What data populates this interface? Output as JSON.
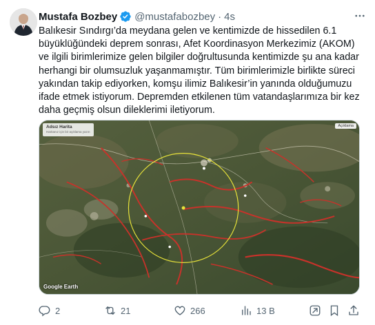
{
  "author": {
    "name": "Mustafa Bozbey",
    "handle": "@mustafabozbey",
    "separator": "·",
    "time": "4s"
  },
  "tweet": {
    "text": "Balıkesir Sındırgı’da meydana gelen ve kentimizde de hissedilen 6.1 büyüklüğündeki deprem sonrası, Afet Koordinasyon Merkezimiz (AKOM) ve ilgili birimlerimize gelen bilgiler doğrultusunda kentimizde şu ana kadar herhangi bir olumsuzluk yaşanmamıştır. Tüm birimlerimizle birlikte süreci yakından takip ediyorken, komşu ilimiz Balıkesir’in yanında olduğumuzu ifade etmek istiyorum. Depremden etkilenen tüm vatandaşlarımıza bir kez daha geçmiş olsun dileklerimi iletiyorum."
  },
  "media": {
    "map_title": "Adsız Harita",
    "map_subtitle": "Haritanız için bir açıklama yazın",
    "legend": "Açıklama",
    "watermark": "Google Earth"
  },
  "actions": {
    "replies": "2",
    "reposts": "21",
    "likes": "266",
    "views": "13 B"
  },
  "icons": {
    "verified": "verified-badge-icon",
    "more": "more-icon",
    "reply": "reply-icon",
    "repost": "repost-icon",
    "like": "heart-icon",
    "views": "views-icon",
    "grok": "grok-icon",
    "bookmark": "bookmark-icon",
    "share": "share-icon"
  },
  "colors": {
    "verified": "#1d9bf0",
    "text": "#0f1419",
    "secondary": "#536471",
    "border": "#cfd9de"
  }
}
